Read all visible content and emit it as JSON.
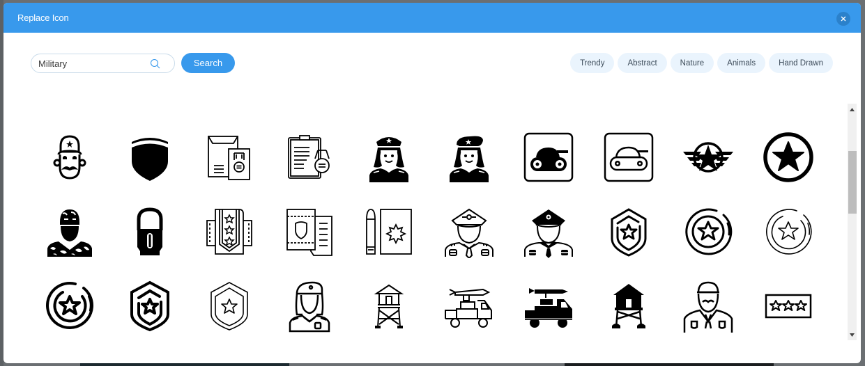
{
  "dialog": {
    "title": "Replace Icon",
    "close_icon": "close-icon",
    "accent_color": "#3899ec"
  },
  "search": {
    "value": "Military",
    "placeholder": "",
    "icon": "search-icon",
    "button_label": "Search"
  },
  "categories": [
    {
      "label": "Trendy"
    },
    {
      "label": "Abstract"
    },
    {
      "label": "Nature"
    },
    {
      "label": "Animals"
    },
    {
      "label": "Hand Drawn"
    }
  ],
  "icons": [
    {
      "name": "soldier-with-moustache-icon"
    },
    {
      "name": "shield-icon"
    },
    {
      "name": "envelope-medal-icon"
    },
    {
      "name": "clipboard-medal-icon"
    },
    {
      "name": "female-officer-cap-icon"
    },
    {
      "name": "female-soldier-beret-icon"
    },
    {
      "name": "tank-solid-icon"
    },
    {
      "name": "tank-outline-icon"
    },
    {
      "name": "winged-star-emblem-icon"
    },
    {
      "name": "star-circle-icon"
    },
    {
      "name": "camouflage-soldier-icon"
    },
    {
      "name": "bullet-icon"
    },
    {
      "name": "rank-stars-strap-icon"
    },
    {
      "name": "shield-document-icon"
    },
    {
      "name": "bullet-badge-icon"
    },
    {
      "name": "officer-outline-icon"
    },
    {
      "name": "officer-solid-icon"
    },
    {
      "name": "shield-star-icon"
    },
    {
      "name": "star-ring-badge-icon"
    },
    {
      "name": "star-ring-thin-icon"
    },
    {
      "name": "star-ring-bold-icon"
    },
    {
      "name": "shield-star-bold-icon"
    },
    {
      "name": "shield-star-thin-icon"
    },
    {
      "name": "female-soldier-outline-icon"
    },
    {
      "name": "watchtower-outline-icon"
    },
    {
      "name": "missile-truck-outline-icon"
    },
    {
      "name": "missile-truck-solid-icon"
    },
    {
      "name": "watchtower-solid-icon"
    },
    {
      "name": "general-officer-icon"
    },
    {
      "name": "three-star-rank-icon"
    }
  ],
  "scrollbar": {
    "position": 0.2
  }
}
